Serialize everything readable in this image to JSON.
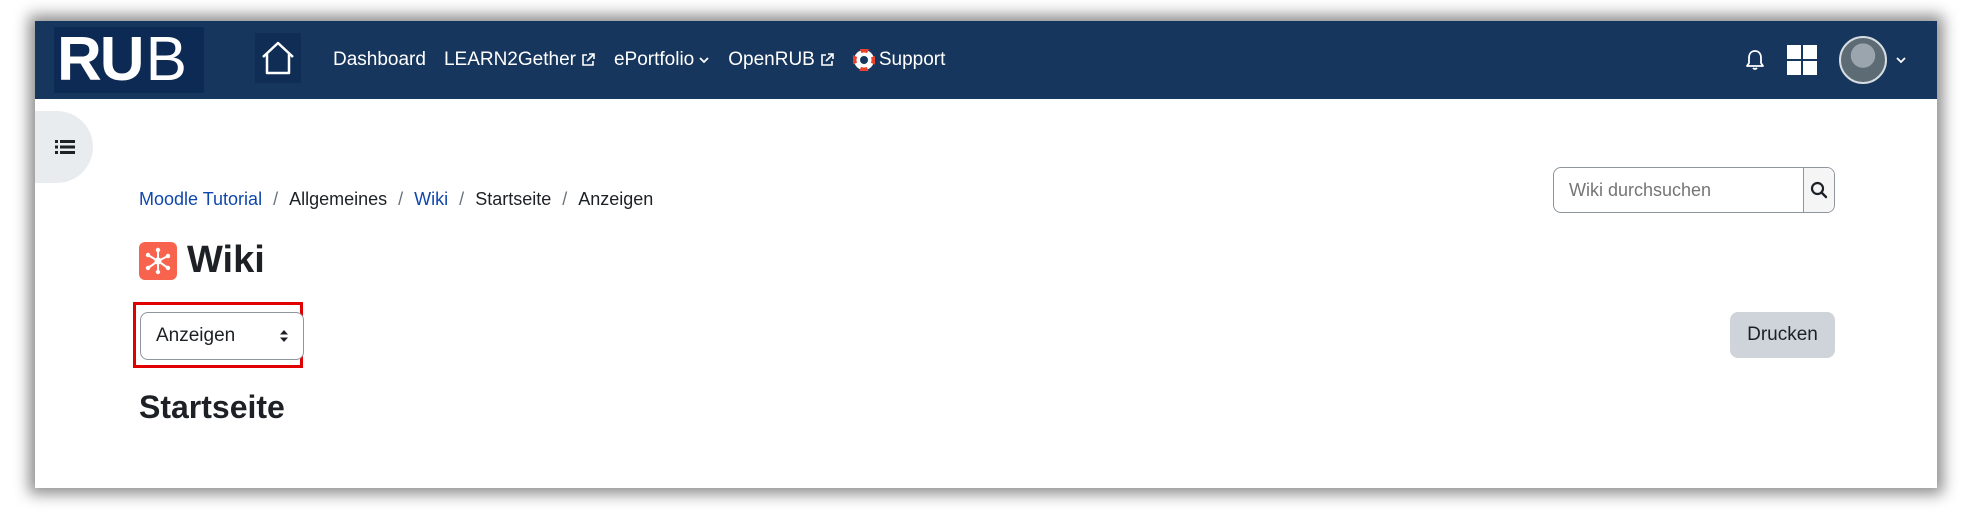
{
  "brand": {
    "logo_text_bold": "RU",
    "logo_text_thin": "B"
  },
  "nav": {
    "items": [
      {
        "label": "Dashboard",
        "external": false,
        "dropdown": false
      },
      {
        "label": "LEARN2Gether",
        "external": true,
        "dropdown": false
      },
      {
        "label": "ePortfolio",
        "external": false,
        "dropdown": true
      },
      {
        "label": "OpenRUB",
        "external": true,
        "dropdown": false
      },
      {
        "label": "Support",
        "external": false,
        "dropdown": false
      }
    ]
  },
  "breadcrumb": {
    "items": [
      "Moodle Tutorial",
      "Allgemeines",
      "Wiki",
      "Startseite",
      "Anzeigen"
    ]
  },
  "page": {
    "title": "Wiki",
    "section_title": "Startseite"
  },
  "view_select": {
    "selected": "Anzeigen"
  },
  "search": {
    "placeholder": "Wiki durchsuchen"
  },
  "actions": {
    "print_label": "Drucken"
  },
  "colors": {
    "navbar": "#17365d",
    "link": "#0f47ad",
    "highlight": "#e00000",
    "wiki_icon": "#f7634d"
  },
  "icons": [
    "home-icon",
    "external-link-icon",
    "chevron-down-icon",
    "lifebuoy-icon",
    "bell-icon",
    "grid-icon",
    "avatar",
    "list-icon",
    "wiki-icon",
    "sort-icon",
    "search-icon"
  ]
}
